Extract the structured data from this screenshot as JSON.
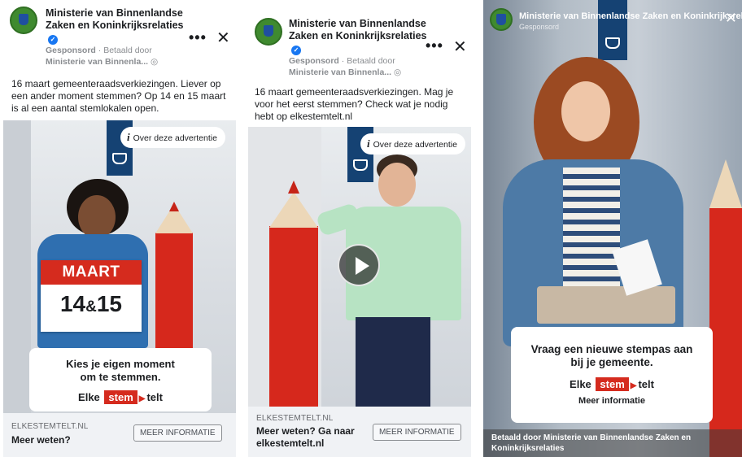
{
  "ads": [
    {
      "page_name": "Ministerie van Binnenlandse Zaken en Koninkrijksrelaties",
      "sponsored": "Gesponsord",
      "paid_by": "Betaald door",
      "paid_by_name": "Ministerie van Binnenla...",
      "body": "16 maart gemeenteraadsverkiezingen. Liever op een ander moment stemmen? Op 14 en 15 maart is al een aantal stemlokalen open.",
      "about_ad": "Over deze advertentie",
      "sign_month": "MAART",
      "sign_day1": "14",
      "sign_amp": "&",
      "sign_day2": "15",
      "card_message": "Kies je eigen moment om te stemmen.",
      "slogan_elke": "Elke",
      "slogan_stem": "stem",
      "slogan_telt": "telt",
      "domain": "ELKESTEMTELT.NL",
      "cta_title": "Meer weten?",
      "cta_button": "MEER INFORMATIE"
    },
    {
      "page_name": "Ministerie van Binnenlandse Zaken en Koninkrijksrelaties",
      "sponsored": "Gesponsord",
      "paid_by": "Betaald door",
      "paid_by_name": "Ministerie van Binnenla...",
      "body": "16 maart gemeenteraadsverkiezingen. Mag je voor het eerst stemmen? Check wat je nodig hebt op elkestemtelt.nl",
      "about_ad": "Over deze advertentie",
      "domain": "ELKESTEMTELT.NL",
      "cta_title": "Meer weten? Ga naar elkestemtelt.nl",
      "cta_button": "MEER INFORMATIE"
    },
    {
      "page_name": "Ministerie van Binnenlandse Zaken en Koninkrijksrelaties",
      "sponsored": "Gesponsord",
      "card_message": "Vraag een nieuwe stempas aan bij je gemeente.",
      "slogan_elke": "Elke",
      "slogan_stem": "stem",
      "slogan_telt": "telt",
      "more_info": "Meer informatie",
      "paid_by_footer": "Betaald door Ministerie van Binnenlandse Zaken en Koninkrijksrelaties"
    }
  ],
  "icons": {
    "menu": "•••",
    "close": "✕",
    "verified": "✓",
    "globe": "◎",
    "info": "i",
    "arrow": "▶"
  },
  "colors": {
    "brand_red": "#d52b1e",
    "rijks_blue": "#154273",
    "facebook_blue": "#1877f2"
  }
}
